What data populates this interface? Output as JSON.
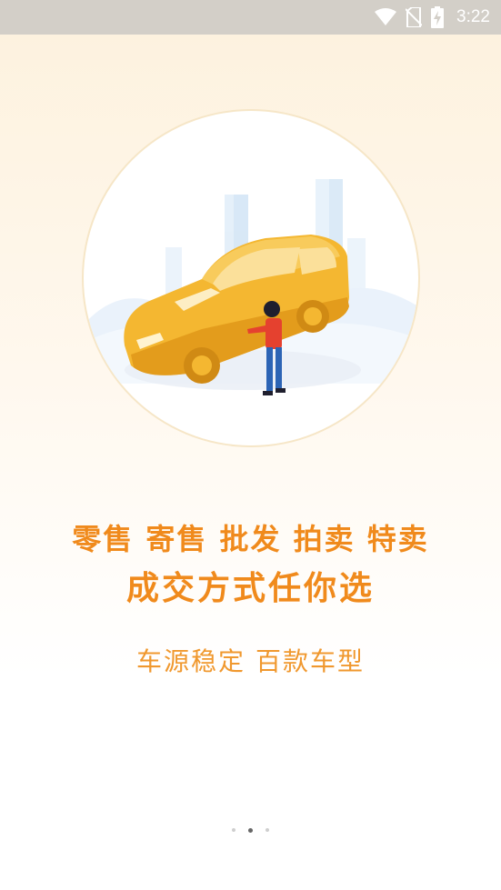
{
  "status_bar": {
    "time": "3:22",
    "icons": [
      "wifi-icon",
      "no-sim-icon",
      "battery-charging-icon"
    ]
  },
  "onboarding": {
    "illustration": "car-and-person-illustration",
    "headline_1": "零售 寄售 批发 拍卖 特卖",
    "headline_2": "成交方式任你选",
    "subline": "车源稳定   百款车型",
    "page_indicator": {
      "total": 3,
      "active_index": 1
    }
  },
  "colors": {
    "accent": "#f08a1c",
    "status_bar": "#d3cfc8",
    "car": "#f4b731"
  }
}
